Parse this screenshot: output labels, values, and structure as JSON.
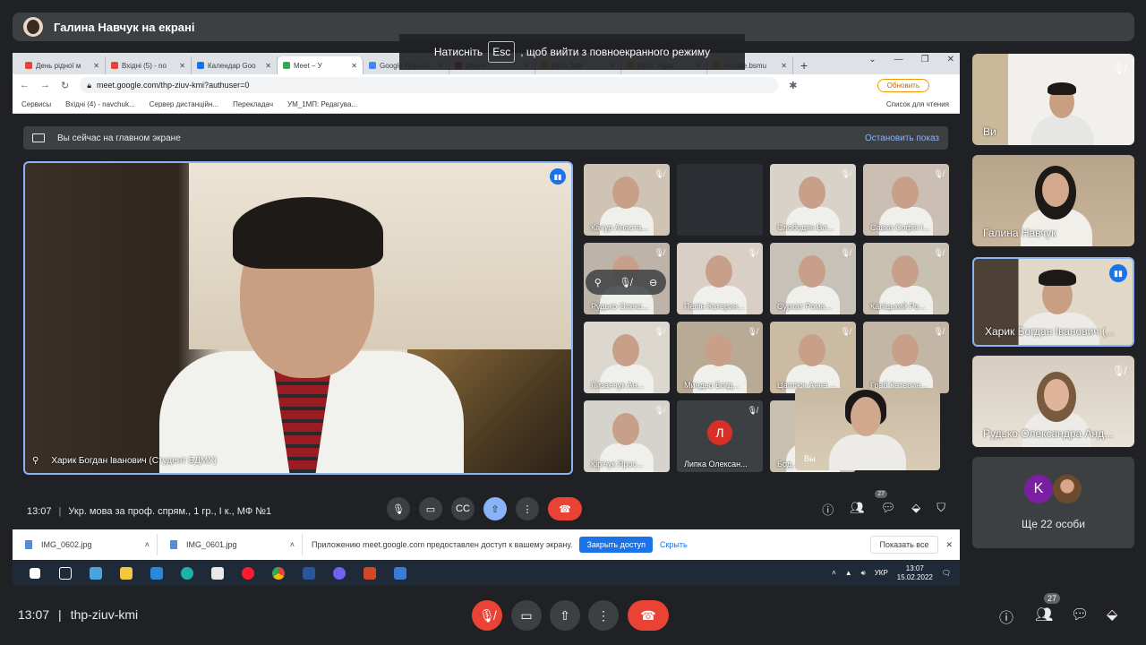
{
  "presenter": {
    "name": "Галина Навчук на екрані"
  },
  "esc_tip": {
    "before": "Натисніть",
    "key": "Esc",
    "after": ", щоб вийти з повноекранного режиму"
  },
  "browser": {
    "tabs": [
      {
        "label": "День рідної м",
        "color": "#ea4335"
      },
      {
        "label": "Вхідні (5) - no",
        "color": "#ea4335"
      },
      {
        "label": "Календар Goo",
        "color": "#1a73e8"
      },
      {
        "label": "Meet – У",
        "color": "#34a853",
        "active": true
      },
      {
        "label": "Google Перекл",
        "color": "#4285f4"
      },
      {
        "label": "Докум",
        "color": "#c5221f"
      },
      {
        "label": "Курс: МФ",
        "color": "#f29900"
      },
      {
        "label": "Курс: Украї",
        "color": "#f29900"
      },
      {
        "label": "moodle.bsmu",
        "color": "#f29900"
      }
    ],
    "new_tab": "+",
    "url": "meet.google.com/thp-ziuv-kmi?authuser=0",
    "update_label": "Обновить",
    "bookmarks": [
      "Сервисы",
      "Вхідні (4) - navchuk...",
      "Сервер дистанційн...",
      "Перекладач",
      "УМ_1МП: Редагува..."
    ],
    "reading_list": "Список для чтения"
  },
  "meet_shared": {
    "sharing_text": "Вы сейчас на главном экране",
    "stop_label": "Остановить показ",
    "main_speaker": "Харик Богдан Іванович (Студент БДМУ)",
    "tiles": [
      {
        "name": "Качур Анаста...",
        "bg": "#cfc3b4"
      },
      {
        "name": "",
        "bg": "#2b2f33"
      },
      {
        "name": "Слободян Вл...",
        "bg": "#d8d2c8"
      },
      {
        "name": "Савка Софія І...",
        "bg": "#cbbfb4"
      },
      {
        "name": "Рудько Олекс...",
        "bg": "#bdb3a8"
      },
      {
        "name": "Пелін Катерин...",
        "bg": "#d9cfc6"
      },
      {
        "name": "Суркат Рома...",
        "bg": "#c7c1b8"
      },
      {
        "name": "Капіцький Ро...",
        "bg": "#c8c0b0"
      },
      {
        "name": "Лизанчук Ан...",
        "bg": "#dcd8d0"
      },
      {
        "name": "Миндьо Богд...",
        "bg": "#b8aa94"
      },
      {
        "name": "Цаплюк Анна ...",
        "bg": "#cbbba2"
      },
      {
        "name": "Граб Катерин...",
        "bg": "#c4b6a4"
      },
      {
        "name": "Кірічук Ярос...",
        "bg": "#d6d2cc"
      },
      {
        "name": "Липка Олексан...",
        "bg": "#3c4043",
        "letter": "Л"
      },
      {
        "name": "Бод...",
        "bg": "#c9bfb0"
      }
    ],
    "self_label": "Вы",
    "time": "13:07",
    "meeting_title": "Укр. мова за проф. спрям., 1 гр., І к., МФ №1",
    "participants_count": "27"
  },
  "downloads": {
    "files": [
      "IMG_0602.jpg",
      "IMG_0601.jpg"
    ],
    "notice": "Приложению meet.google.com предоставлен доступ к вашему экрану.",
    "close_access": "Закрыть доступ",
    "hide": "Скрыть",
    "show_all": "Показать все"
  },
  "taskbar": {
    "lang": "УКР",
    "time": "13:07",
    "date": "15.02.2022"
  },
  "sidebar": [
    {
      "name": "Ви",
      "muted": true
    },
    {
      "name": "Галина Навчук",
      "muted": false
    },
    {
      "name": "Харик Богдан Іванович (...",
      "speaking": true
    },
    {
      "name": "Рудько Олександра Анд...",
      "muted": true
    }
  ],
  "more": {
    "letter": "K",
    "text": "Ще 22 особи"
  },
  "bottom": {
    "time": "13:07",
    "code": "thp-ziuv-kmi",
    "participants_count": "27"
  },
  "colors": {
    "accent": "#8ab4f8",
    "hangup": "#ea4335",
    "bg": "#202124"
  }
}
